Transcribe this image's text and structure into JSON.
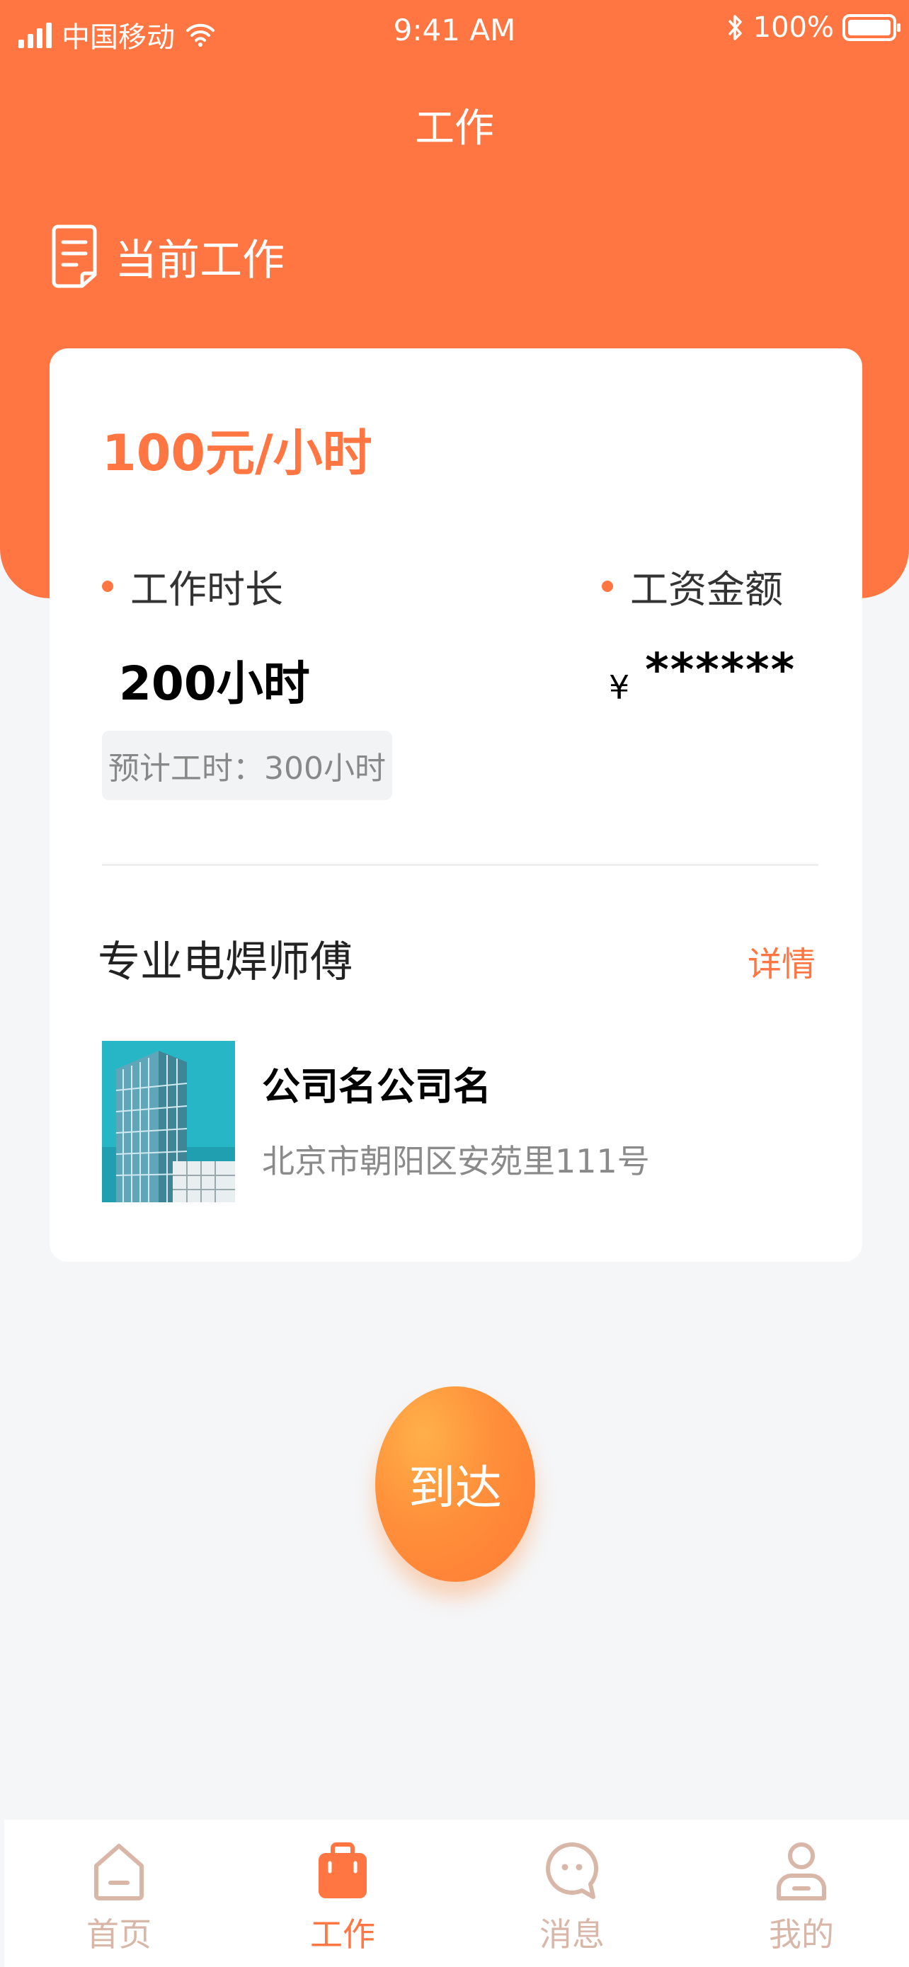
{
  "status_bar": {
    "carrier": "中国移动",
    "time": "9:41 AM",
    "battery": "100%"
  },
  "header": {
    "title": "工作",
    "section_title": "当前工作"
  },
  "job_card": {
    "rate": "100元/小时",
    "hours_label": "工作时长",
    "hours_value": "200小时",
    "salary_label": "工资金额",
    "currency": "¥",
    "salary_value": "******",
    "estimate": "预计工时：300小时",
    "job_title": "专业电焊师傅",
    "detail_link": "详情",
    "company_name": "公司名公司名",
    "company_address": "北京市朝阳区安苑里111号"
  },
  "arrive_button": "到达",
  "tabbar": {
    "items": [
      {
        "label": "首页",
        "icon": "home-icon",
        "active": false
      },
      {
        "label": "工作",
        "icon": "briefcase-icon",
        "active": true
      },
      {
        "label": "消息",
        "icon": "message-icon",
        "active": false
      },
      {
        "label": "我的",
        "icon": "profile-icon",
        "active": false
      }
    ]
  },
  "colors": {
    "accent": "#ff7643",
    "background": "#f5f6f8",
    "tab_inactive": "#d9b7a8"
  }
}
